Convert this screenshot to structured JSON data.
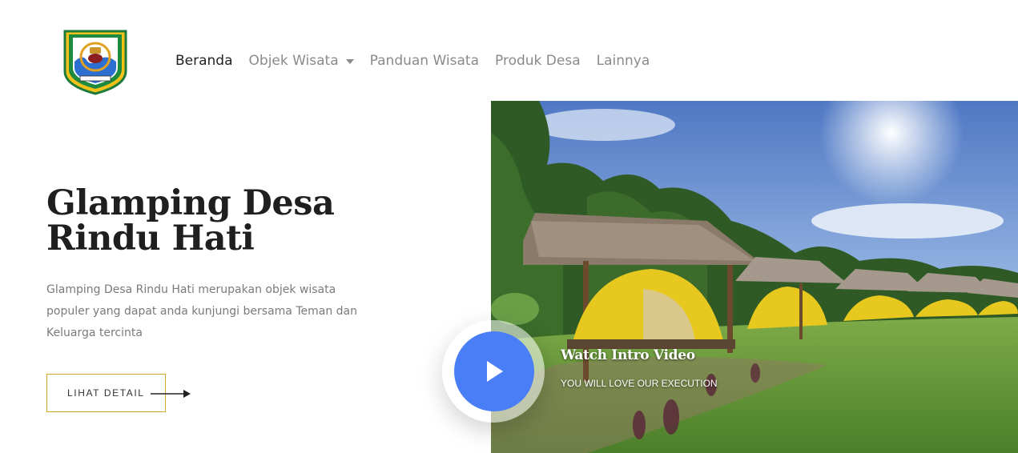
{
  "header": {
    "logo": {
      "icon": "regency-coat-of-arms-icon"
    },
    "nav": [
      {
        "label": "Beranda",
        "active": true
      },
      {
        "label": "Objek Wisata",
        "dropdown": true
      },
      {
        "label": "Panduan Wisata"
      },
      {
        "label": "Produk Desa"
      },
      {
        "label": "Lainnya"
      }
    ]
  },
  "hero": {
    "title_line1": "Glamping Desa",
    "title_line2": "Rindu Hati",
    "description": "Glamping Desa Rindu Hati merupakan objek wisata populer yang dapat anda kunjungi bersama Teman dan Keluarga tercinta",
    "detail_button": "LIHAT DETAIL"
  },
  "video": {
    "title": "Watch Intro Video",
    "subtitle": "YOU WILL LOVE OUR EXECUTION",
    "play_icon": "play-icon"
  },
  "colors": {
    "accent_border": "#d4a72c",
    "play_button": "#4a7ef6",
    "text_dark": "#1f1f1f",
    "text_muted": "#7a7a7a"
  }
}
